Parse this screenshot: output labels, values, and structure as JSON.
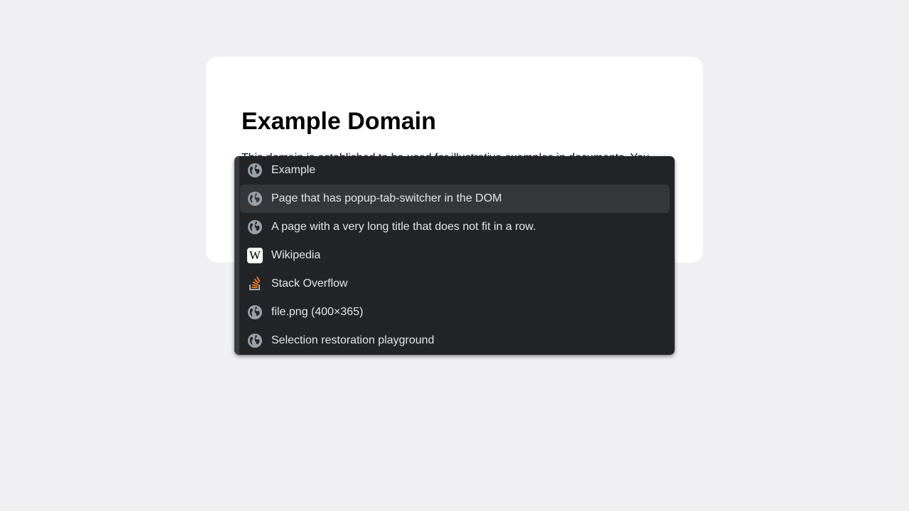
{
  "page": {
    "heading": "Example Domain",
    "body_text": "This domain is established to be used for illustrative examples in documents. You"
  },
  "switcher": {
    "tabs": [
      {
        "title": "Example",
        "icon": "globe-icon"
      },
      {
        "title": "Page that has popup-tab-switcher in the DOM",
        "icon": "globe-icon",
        "selected": true
      },
      {
        "title": "A page with a very long title that does not fit in a row.",
        "icon": "globe-icon"
      },
      {
        "title": "Wikipedia",
        "icon": "wikipedia-icon",
        "icon_glyph": "W"
      },
      {
        "title": "Stack Overflow",
        "icon": "stackoverflow-icon"
      },
      {
        "title": "file.png (400×365)",
        "icon": "globe-icon"
      },
      {
        "title": "Selection restoration playground",
        "icon": "globe-icon"
      }
    ]
  },
  "colors": {
    "background": "#f0f0f2",
    "switcher_bg": "#232428",
    "selected_row": "#35373b",
    "globe": "#9aa0a6",
    "stackoverflow_orange": "#f48024"
  }
}
